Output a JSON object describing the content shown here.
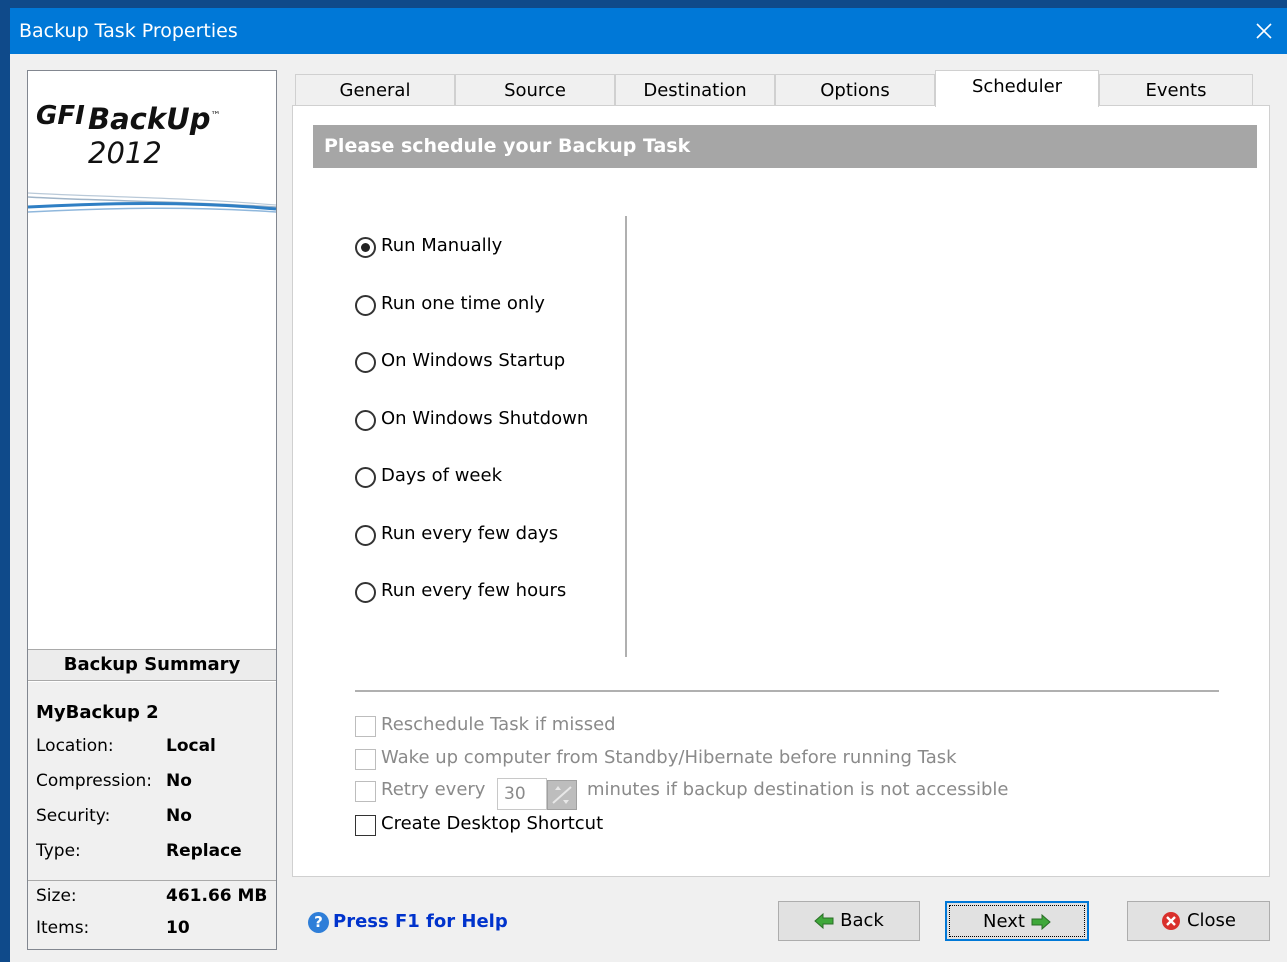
{
  "window": {
    "title": "Backup Task Properties",
    "close_glyph": "✕"
  },
  "logo": {
    "brand": "GFI",
    "product": "BackUp",
    "version": "2012",
    "tm": "™"
  },
  "summary": {
    "header": "Backup Summary",
    "name": "MyBackup 2",
    "rows": [
      {
        "key": "Location:",
        "value": "Local"
      },
      {
        "key": "Compression:",
        "value": "No"
      },
      {
        "key": "Security:",
        "value": "No"
      },
      {
        "key": "Type:",
        "value": "Replace"
      },
      {
        "key": "Size:",
        "value": "461.66 MB"
      },
      {
        "key": "Items:",
        "value": "10"
      }
    ]
  },
  "tabs": [
    {
      "label": "General"
    },
    {
      "label": "Source"
    },
    {
      "label": "Destination"
    },
    {
      "label": "Options"
    },
    {
      "label": "Scheduler",
      "active": true
    },
    {
      "label": "Events"
    }
  ],
  "scheduler": {
    "header": "Please schedule your Backup Task",
    "options": [
      {
        "label": "Run Manually",
        "checked": true
      },
      {
        "label": "Run one time only",
        "checked": false
      },
      {
        "label": "On Windows Startup",
        "checked": false
      },
      {
        "label": "On Windows Shutdown",
        "checked": false
      },
      {
        "label": "Days of week",
        "checked": false
      },
      {
        "label": "Run every few days",
        "checked": false
      },
      {
        "label": "Run every few hours",
        "checked": false
      }
    ],
    "reschedule_label": "Reschedule Task if missed",
    "wakeup_label": "Wake up computer from Standby/Hibernate before running Task",
    "retry_prefix": "Retry every",
    "retry_value": "30",
    "retry_suffix": "minutes if backup destination is not accessible",
    "shortcut_label": "Create Desktop Shortcut"
  },
  "footer": {
    "help_label": "Press F1 for Help",
    "back_label": "Back",
    "next_label": "Next",
    "close_label": "Close"
  },
  "colors": {
    "titlebar": "#0078d7",
    "header_bar": "#a6a6a6",
    "link": "#0033cc"
  }
}
